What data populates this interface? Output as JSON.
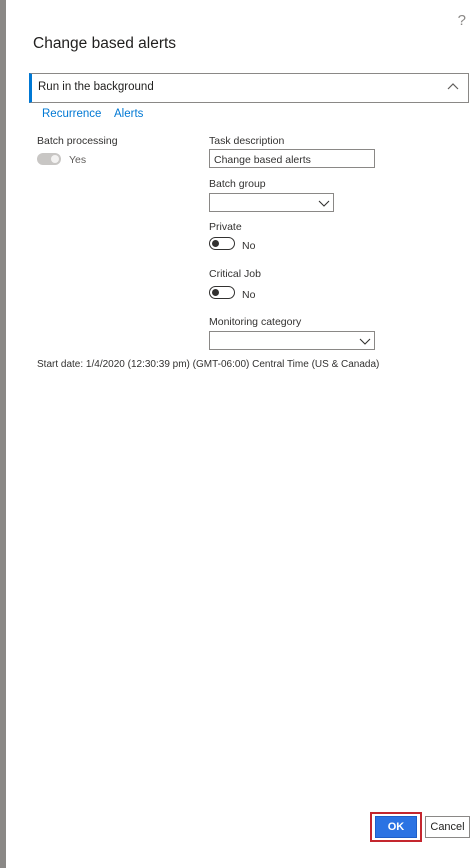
{
  "dialog": {
    "help_glyph": "?",
    "title": "Change based alerts"
  },
  "section": {
    "label": "Run in the background"
  },
  "links": {
    "recurrence": "Recurrence",
    "alerts": "Alerts"
  },
  "batch_processing": {
    "label": "Batch processing",
    "value": "Yes",
    "enabled": false
  },
  "task_description": {
    "label": "Task description",
    "value": "Change based alerts"
  },
  "batch_group": {
    "label": "Batch group",
    "value": ""
  },
  "private": {
    "label": "Private",
    "value": "No"
  },
  "critical_job": {
    "label": "Critical Job",
    "value": "No"
  },
  "monitoring_category": {
    "label": "Monitoring category",
    "value": ""
  },
  "start_date": "Start date: 1/4/2020 (12:30:39 pm) (GMT-06:00) Central Time (US & Canada)",
  "buttons": {
    "ok": "OK",
    "cancel": "Cancel"
  },
  "colors": {
    "accent": "#0078d4",
    "ok_button": "#2b73e3",
    "highlight": "#c4262e"
  }
}
